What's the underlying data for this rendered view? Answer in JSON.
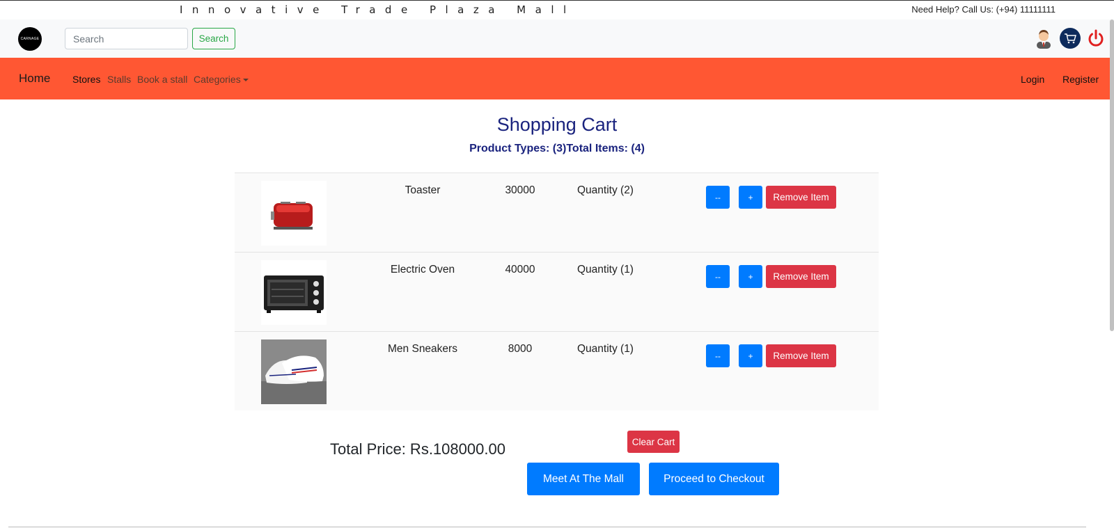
{
  "top": {
    "mall_title": "Innovative Trade Plaza Mall",
    "help_text": "Need Help? Call Us: (+94) 11111111"
  },
  "search": {
    "logo_text": "CARNAGE",
    "placeholder": "Search",
    "button_label": "Search"
  },
  "header_icons": [
    "user-icon",
    "cart-icon",
    "power-icon"
  ],
  "nav": {
    "brand": "Home",
    "links": [
      "Stores",
      "Stalls",
      "Book a stall",
      "Categories"
    ],
    "right": [
      "Login",
      "Register"
    ]
  },
  "cart": {
    "title": "Shopping Cart",
    "summary": "Product Types: (3)Total Items: (4)",
    "items": [
      {
        "name": "Toaster",
        "price": "30000",
        "quantity": "Quantity (2)",
        "image": "toaster"
      },
      {
        "name": "Electric Oven",
        "price": "40000",
        "quantity": "Quantity (1)",
        "image": "oven"
      },
      {
        "name": "Men Sneakers",
        "price": "8000",
        "quantity": "Quantity (1)",
        "image": "sneakers"
      }
    ],
    "dec_label": "--",
    "inc_label": "+",
    "remove_label": "Remove Item",
    "total_price": "Total Price: Rs.108000.00",
    "clear_label": "Clear Cart",
    "meet_label": "Meet At The Mall",
    "checkout_label": "Proceed to Checkout"
  },
  "colors": {
    "navbar": "#ff5733",
    "primary": "#007bff",
    "danger": "#dc3545",
    "success": "#28a745",
    "heading": "#1a237e"
  }
}
